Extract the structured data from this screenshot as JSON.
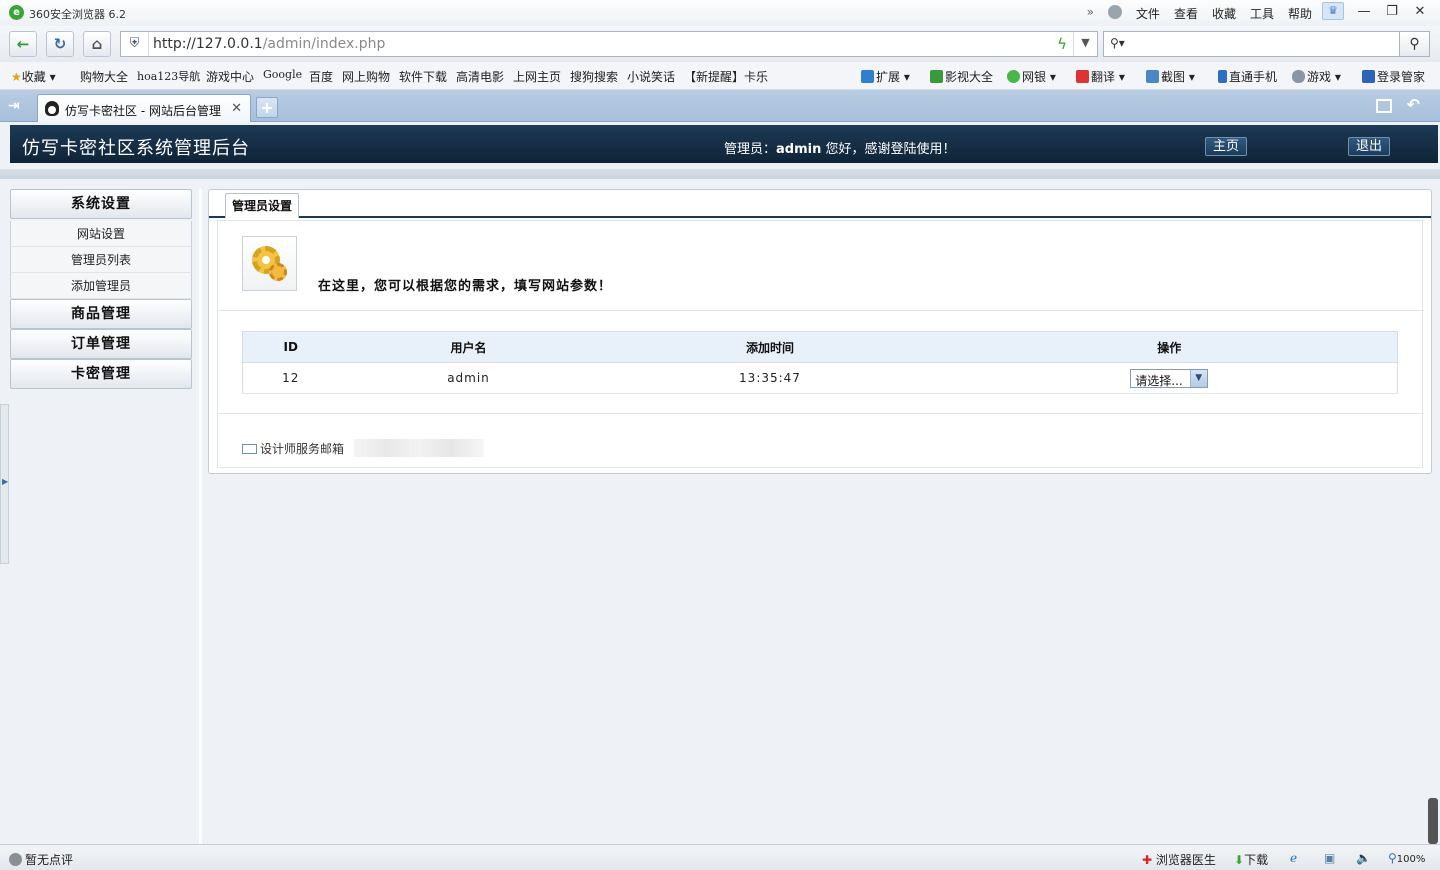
{
  "browser": {
    "app_title": "360安全浏览器 6.2",
    "menus": [
      "文件",
      "查看",
      "收藏",
      "工具",
      "帮助"
    ],
    "url_host": "http://127.0.0.1",
    "url_path": "/admin/index.php",
    "favorites": [
      {
        "label": "收藏"
      },
      {
        "label": "购物大全"
      },
      {
        "label": "hoa123导航"
      },
      {
        "label": "游戏中心"
      },
      {
        "label": "Google"
      },
      {
        "label": "百度"
      },
      {
        "label": "网上购物"
      },
      {
        "label": "软件下载"
      },
      {
        "label": "高清电影"
      },
      {
        "label": "上网主页"
      },
      {
        "label": "搜狗搜索"
      },
      {
        "label": "小说笑话"
      },
      {
        "label": "【新提醒】卡乐"
      }
    ],
    "right_tools": [
      {
        "label": "扩展"
      },
      {
        "label": "影视大全"
      },
      {
        "label": "网银"
      },
      {
        "label": "翻译"
      },
      {
        "label": "截图"
      },
      {
        "label": "直通手机"
      },
      {
        "label": "游戏"
      },
      {
        "label": "登录管家"
      }
    ],
    "tab_title": "仿写卡密社区 - 网站后台管理",
    "status_left": "暂无点评",
    "status_items": [
      "浏览器医生",
      "下载",
      "100%"
    ]
  },
  "header": {
    "site_title": "仿写卡密社区系统管理后台",
    "welcome_prefix": "管理员：",
    "admin_name": "admin",
    "welcome_suffix": " 您好，感谢登陆使用！",
    "home_label": "主页",
    "logout_label": "退出"
  },
  "sidebar": {
    "sections": [
      {
        "title": "系统设置",
        "items": [
          "网站设置",
          "管理员列表",
          "添加管理员"
        ]
      },
      {
        "title": "商品管理"
      },
      {
        "title": "订单管理"
      },
      {
        "title": "卡密管理"
      }
    ]
  },
  "main": {
    "tab_label": "管理员设置",
    "intro": "在这里，您可以根据您的需求，填写网站参数！",
    "table": {
      "headers": [
        "ID",
        "用户名",
        "添加时间",
        "操作"
      ],
      "rows": [
        {
          "id": "12",
          "username": "admin",
          "time": "13:35:47",
          "action": "请选择..."
        }
      ]
    },
    "footer_label": "设计师服务邮箱"
  }
}
